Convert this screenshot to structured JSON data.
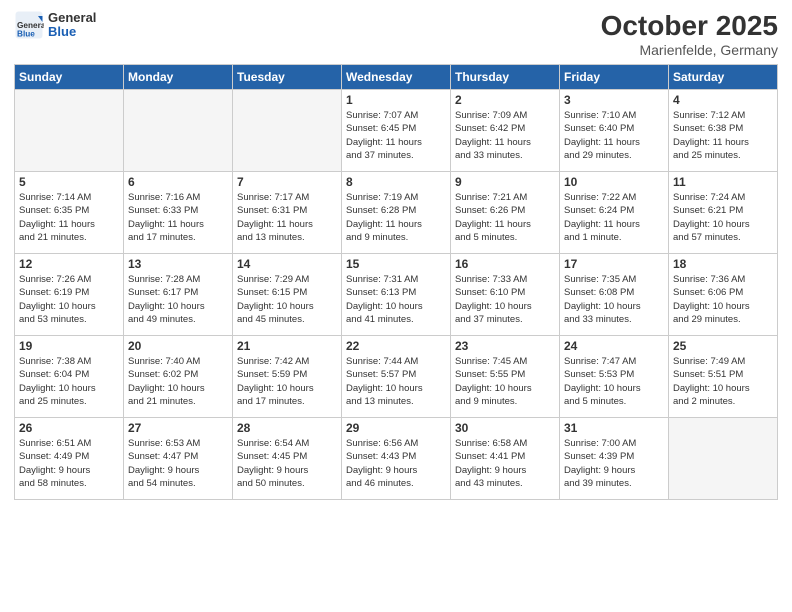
{
  "header": {
    "logo": {
      "general": "General",
      "blue": "Blue"
    },
    "title": "October 2025",
    "location": "Marienfelde, Germany"
  },
  "weekdays": [
    "Sunday",
    "Monday",
    "Tuesday",
    "Wednesday",
    "Thursday",
    "Friday",
    "Saturday"
  ],
  "weeks": [
    [
      {
        "day": "",
        "info": ""
      },
      {
        "day": "",
        "info": ""
      },
      {
        "day": "",
        "info": ""
      },
      {
        "day": "1",
        "info": "Sunrise: 7:07 AM\nSunset: 6:45 PM\nDaylight: 11 hours\nand 37 minutes."
      },
      {
        "day": "2",
        "info": "Sunrise: 7:09 AM\nSunset: 6:42 PM\nDaylight: 11 hours\nand 33 minutes."
      },
      {
        "day": "3",
        "info": "Sunrise: 7:10 AM\nSunset: 6:40 PM\nDaylight: 11 hours\nand 29 minutes."
      },
      {
        "day": "4",
        "info": "Sunrise: 7:12 AM\nSunset: 6:38 PM\nDaylight: 11 hours\nand 25 minutes."
      }
    ],
    [
      {
        "day": "5",
        "info": "Sunrise: 7:14 AM\nSunset: 6:35 PM\nDaylight: 11 hours\nand 21 minutes."
      },
      {
        "day": "6",
        "info": "Sunrise: 7:16 AM\nSunset: 6:33 PM\nDaylight: 11 hours\nand 17 minutes."
      },
      {
        "day": "7",
        "info": "Sunrise: 7:17 AM\nSunset: 6:31 PM\nDaylight: 11 hours\nand 13 minutes."
      },
      {
        "day": "8",
        "info": "Sunrise: 7:19 AM\nSunset: 6:28 PM\nDaylight: 11 hours\nand 9 minutes."
      },
      {
        "day": "9",
        "info": "Sunrise: 7:21 AM\nSunset: 6:26 PM\nDaylight: 11 hours\nand 5 minutes."
      },
      {
        "day": "10",
        "info": "Sunrise: 7:22 AM\nSunset: 6:24 PM\nDaylight: 11 hours\nand 1 minute."
      },
      {
        "day": "11",
        "info": "Sunrise: 7:24 AM\nSunset: 6:21 PM\nDaylight: 10 hours\nand 57 minutes."
      }
    ],
    [
      {
        "day": "12",
        "info": "Sunrise: 7:26 AM\nSunset: 6:19 PM\nDaylight: 10 hours\nand 53 minutes."
      },
      {
        "day": "13",
        "info": "Sunrise: 7:28 AM\nSunset: 6:17 PM\nDaylight: 10 hours\nand 49 minutes."
      },
      {
        "day": "14",
        "info": "Sunrise: 7:29 AM\nSunset: 6:15 PM\nDaylight: 10 hours\nand 45 minutes."
      },
      {
        "day": "15",
        "info": "Sunrise: 7:31 AM\nSunset: 6:13 PM\nDaylight: 10 hours\nand 41 minutes."
      },
      {
        "day": "16",
        "info": "Sunrise: 7:33 AM\nSunset: 6:10 PM\nDaylight: 10 hours\nand 37 minutes."
      },
      {
        "day": "17",
        "info": "Sunrise: 7:35 AM\nSunset: 6:08 PM\nDaylight: 10 hours\nand 33 minutes."
      },
      {
        "day": "18",
        "info": "Sunrise: 7:36 AM\nSunset: 6:06 PM\nDaylight: 10 hours\nand 29 minutes."
      }
    ],
    [
      {
        "day": "19",
        "info": "Sunrise: 7:38 AM\nSunset: 6:04 PM\nDaylight: 10 hours\nand 25 minutes."
      },
      {
        "day": "20",
        "info": "Sunrise: 7:40 AM\nSunset: 6:02 PM\nDaylight: 10 hours\nand 21 minutes."
      },
      {
        "day": "21",
        "info": "Sunrise: 7:42 AM\nSunset: 5:59 PM\nDaylight: 10 hours\nand 17 minutes."
      },
      {
        "day": "22",
        "info": "Sunrise: 7:44 AM\nSunset: 5:57 PM\nDaylight: 10 hours\nand 13 minutes."
      },
      {
        "day": "23",
        "info": "Sunrise: 7:45 AM\nSunset: 5:55 PM\nDaylight: 10 hours\nand 9 minutes."
      },
      {
        "day": "24",
        "info": "Sunrise: 7:47 AM\nSunset: 5:53 PM\nDaylight: 10 hours\nand 5 minutes."
      },
      {
        "day": "25",
        "info": "Sunrise: 7:49 AM\nSunset: 5:51 PM\nDaylight: 10 hours\nand 2 minutes."
      }
    ],
    [
      {
        "day": "26",
        "info": "Sunrise: 6:51 AM\nSunset: 4:49 PM\nDaylight: 9 hours\nand 58 minutes."
      },
      {
        "day": "27",
        "info": "Sunrise: 6:53 AM\nSunset: 4:47 PM\nDaylight: 9 hours\nand 54 minutes."
      },
      {
        "day": "28",
        "info": "Sunrise: 6:54 AM\nSunset: 4:45 PM\nDaylight: 9 hours\nand 50 minutes."
      },
      {
        "day": "29",
        "info": "Sunrise: 6:56 AM\nSunset: 4:43 PM\nDaylight: 9 hours\nand 46 minutes."
      },
      {
        "day": "30",
        "info": "Sunrise: 6:58 AM\nSunset: 4:41 PM\nDaylight: 9 hours\nand 43 minutes."
      },
      {
        "day": "31",
        "info": "Sunrise: 7:00 AM\nSunset: 4:39 PM\nDaylight: 9 hours\nand 39 minutes."
      },
      {
        "day": "",
        "info": ""
      }
    ]
  ]
}
